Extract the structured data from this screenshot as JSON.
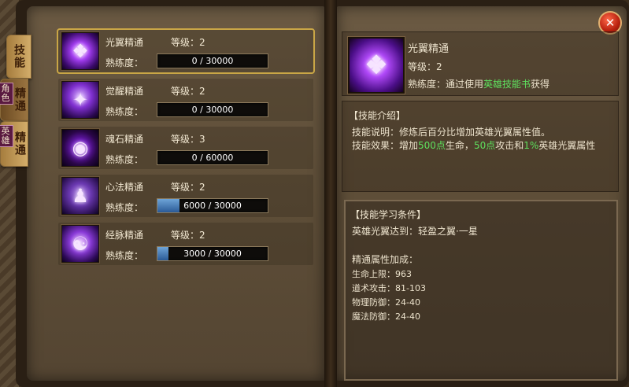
{
  "tabs": [
    {
      "label": "技能",
      "active": true
    },
    {
      "label": "精通",
      "badge": "角色",
      "active": false
    },
    {
      "label": "精通",
      "badge": "英雄",
      "active": true
    }
  ],
  "close_label": "✕",
  "skills": [
    {
      "name": "光翼精通",
      "level_text": "等级：2",
      "prof_label": "熟练度：",
      "progress": "0 / 30000",
      "fraction": 0.0,
      "selected": true
    },
    {
      "name": "觉醒精通",
      "level_text": "等级：2",
      "prof_label": "熟练度：",
      "progress": "0 / 30000",
      "fraction": 0.0
    },
    {
      "name": "魂石精通",
      "level_text": "等级：3",
      "prof_label": "熟练度：",
      "progress": "0 / 60000",
      "fraction": 0.0
    },
    {
      "name": "心法精通",
      "level_text": "等级：2",
      "prof_label": "熟练度：",
      "progress": "6000 / 30000",
      "fraction": 0.2
    },
    {
      "name": "经脉精通",
      "level_text": "等级：2",
      "prof_label": "熟练度：",
      "progress": "3000 / 30000",
      "fraction": 0.1
    }
  ],
  "detail": {
    "name": "光翼精通",
    "level_text": "等级：2",
    "prof_prefix": "熟练度：通过使用",
    "prof_link": "英雄技能书",
    "prof_suffix": "获得"
  },
  "intro": {
    "title": "【技能介绍】",
    "desc": "技能说明：修炼后百分比增加英雄光翼属性值。",
    "effect_prefix": "技能效果：增加",
    "hp": "500点",
    "hp_suffix": "生命，",
    "atk": "50点",
    "atk_suffix": "攻击和",
    "pct": "1%",
    "pct_suffix": "英雄光翼属性"
  },
  "conditions": {
    "title": "【技能学习条件】",
    "requirement": "英雄光翼达到：轻盈之翼·一星",
    "bonus_title": "精通属性加成：",
    "stats": [
      "生命上限：963",
      "道术攻击：81-103",
      "物理防御：24-40",
      "魔法防御：24-40"
    ]
  },
  "colors": {
    "highlight": "#5ee05e",
    "selected_border": "#c9a646",
    "progress_fill": "#3a6aa8"
  }
}
